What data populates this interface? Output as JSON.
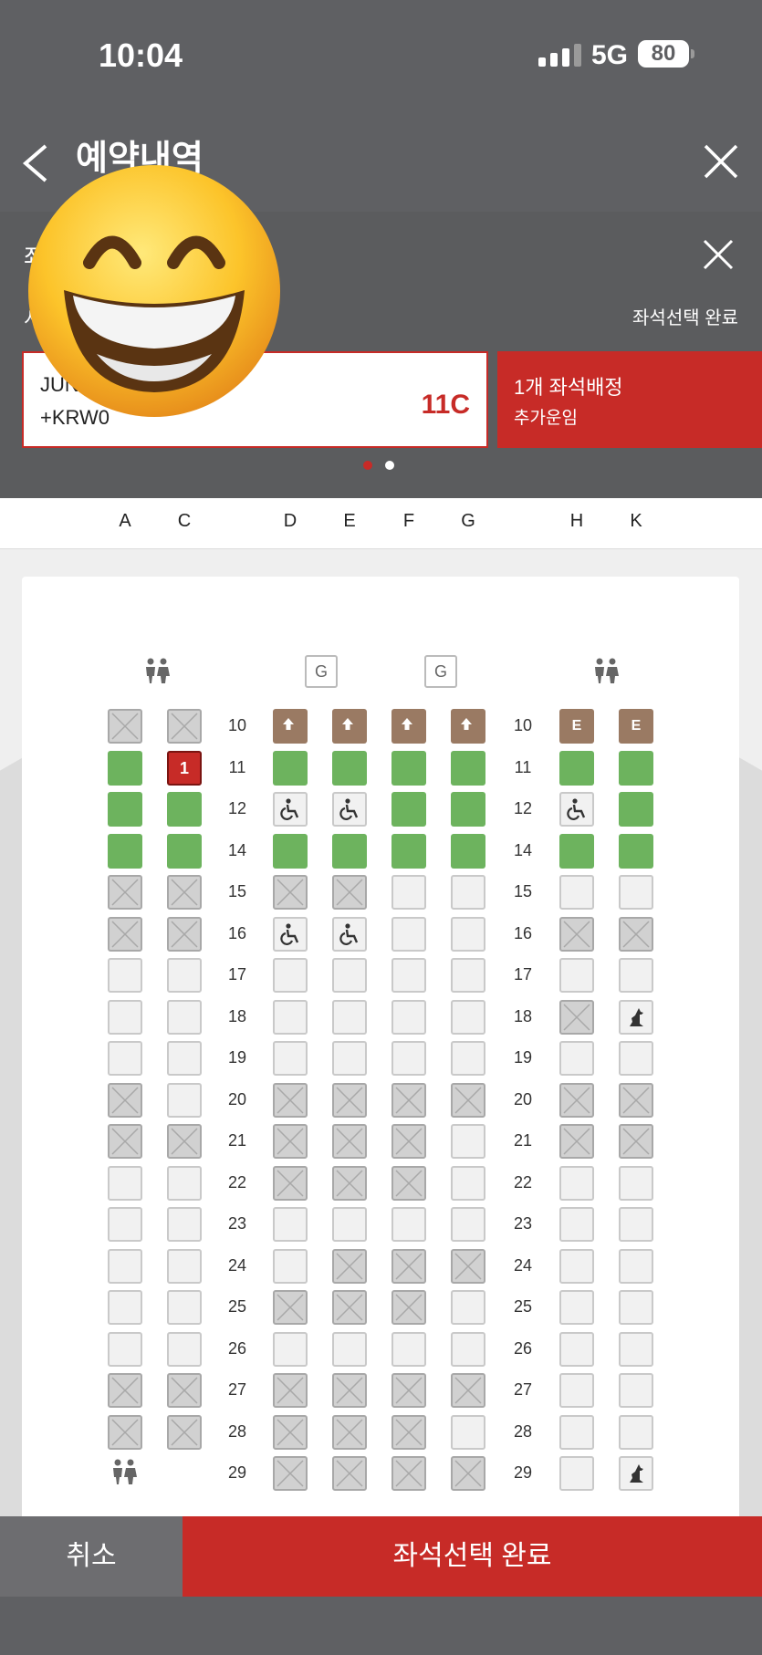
{
  "status_bar": {
    "time": "10:04",
    "network": "5G",
    "battery": "80"
  },
  "header": {
    "title": "예약내역"
  },
  "panel": {
    "title": "좌",
    "subtitle": "시",
    "complete_link": "좌석선택 완료",
    "passenger": {
      "name": "JUN",
      "fare": "+KRW0",
      "seat": "11C"
    },
    "assign_card": {
      "title": "1개 좌석배정",
      "subtitle": "추가운임"
    }
  },
  "columns": [
    "A",
    "C",
    "D",
    "E",
    "F",
    "G",
    "H",
    "K"
  ],
  "galley_label": "G",
  "rows": [
    {
      "num": "10",
      "seats": [
        "x",
        "x",
        "bassinet",
        "bassinet",
        "bassinet",
        "bassinet",
        "exit",
        "exit"
      ]
    },
    {
      "num": "11",
      "seats": [
        "g",
        "sel",
        "g",
        "g",
        "g",
        "g",
        "g",
        "g"
      ]
    },
    {
      "num": "12",
      "seats": [
        "g",
        "g",
        "wc",
        "wc",
        "g",
        "g",
        "wc",
        "g"
      ]
    },
    {
      "num": "14",
      "seats": [
        "g",
        "g",
        "g",
        "g",
        "g",
        "g",
        "g",
        "g"
      ]
    },
    {
      "num": "15",
      "seats": [
        "x",
        "x",
        "x",
        "x",
        "a",
        "a",
        "a",
        "a"
      ]
    },
    {
      "num": "16",
      "seats": [
        "x",
        "x",
        "wc",
        "wc",
        "a",
        "a",
        "x",
        "x"
      ]
    },
    {
      "num": "17",
      "seats": [
        "a",
        "a",
        "a",
        "a",
        "a",
        "a",
        "a",
        "a"
      ]
    },
    {
      "num": "18",
      "seats": [
        "a",
        "a",
        "a",
        "a",
        "a",
        "a",
        "x",
        "pet"
      ]
    },
    {
      "num": "19",
      "seats": [
        "a",
        "a",
        "a",
        "a",
        "a",
        "a",
        "a",
        "a"
      ]
    },
    {
      "num": "20",
      "seats": [
        "x",
        "a",
        "x",
        "x",
        "x",
        "x",
        "x",
        "x"
      ]
    },
    {
      "num": "21",
      "seats": [
        "x",
        "x",
        "x",
        "x",
        "x",
        "a",
        "x",
        "x"
      ]
    },
    {
      "num": "22",
      "seats": [
        "a",
        "a",
        "x",
        "x",
        "x",
        "a",
        "a",
        "a"
      ]
    },
    {
      "num": "23",
      "seats": [
        "a",
        "a",
        "a",
        "a",
        "a",
        "a",
        "a",
        "a"
      ]
    },
    {
      "num": "24",
      "seats": [
        "a",
        "a",
        "a",
        "x",
        "x",
        "x",
        "a",
        "a"
      ]
    },
    {
      "num": "25",
      "seats": [
        "a",
        "a",
        "x",
        "x",
        "x",
        "a",
        "a",
        "a"
      ]
    },
    {
      "num": "26",
      "seats": [
        "a",
        "a",
        "a",
        "a",
        "a",
        "a",
        "a",
        "a"
      ]
    },
    {
      "num": "27",
      "seats": [
        "x",
        "x",
        "x",
        "x",
        "x",
        "x",
        "a",
        "a"
      ]
    },
    {
      "num": "28",
      "seats": [
        "x",
        "x",
        "x",
        "x",
        "x",
        "a",
        "a",
        "a"
      ]
    },
    {
      "num": "29",
      "seats": [
        "none",
        "none",
        "x",
        "x",
        "x",
        "x",
        "a",
        "pet"
      ]
    }
  ],
  "exit_label": "E",
  "selected_label": "1",
  "bottom": {
    "cancel": "취소",
    "confirm": "좌석선택 완료"
  },
  "colors": {
    "accent": "#c72b27",
    "available_green": "#6db35e",
    "special": "#9a7a63",
    "occupied": "#d1d1d1"
  },
  "icons": [
    "back-arrow-icon",
    "close-icon",
    "lavatory-icon",
    "wheelchair-icon",
    "pet-icon",
    "bassinet-arrow-icon"
  ]
}
